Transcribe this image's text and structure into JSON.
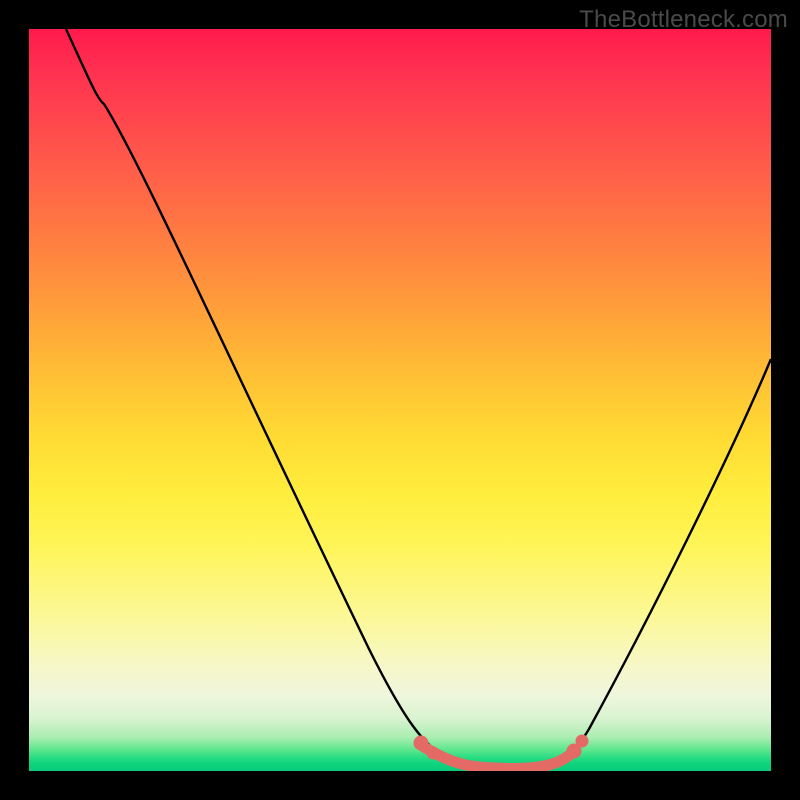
{
  "watermark": "TheBottleneck.com",
  "colors": {
    "frame": "#000000",
    "curve": "#000000",
    "marker": "#e46a66",
    "grad_top": "#ff1a4d",
    "grad_mid": "#ffee3e",
    "grad_bottom": "#0acb7b"
  },
  "chart_data": {
    "type": "line",
    "title": "",
    "xlabel": "",
    "ylabel": "",
    "xlim": [
      0,
      100
    ],
    "ylim": [
      0,
      100
    ],
    "series": [
      {
        "name": "bottleneck-curve",
        "x": [
          5,
          10,
          15,
          20,
          25,
          30,
          35,
          40,
          45,
          50,
          53,
          56,
          60,
          64,
          68,
          72,
          76,
          80,
          85,
          90,
          95,
          100
        ],
        "values": [
          100,
          90,
          80.5,
          71,
          61,
          51,
          41,
          31,
          22,
          13,
          7,
          3.5,
          1.5,
          0.8,
          0.8,
          2,
          6,
          13,
          24,
          35,
          47,
          58
        ]
      }
    ],
    "markers": {
      "name": "flat-minimum-band",
      "x": [
        53,
        56,
        58,
        60,
        62,
        64,
        66,
        68,
        70,
        72
      ],
      "values": [
        7,
        3.5,
        2.2,
        1.5,
        1.0,
        0.8,
        0.8,
        0.8,
        1.2,
        2
      ]
    }
  }
}
